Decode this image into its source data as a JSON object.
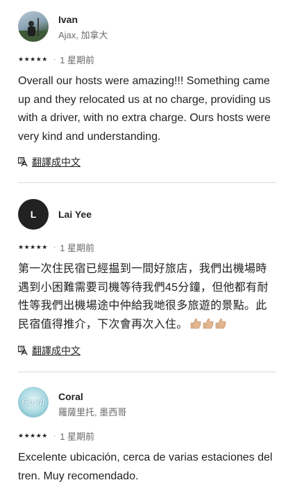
{
  "reviews": [
    {
      "name": "Ivan",
      "location": "Ajax, 加拿大",
      "stars": "★★★★★",
      "time": "1 星期前",
      "text": "Overall our hosts were amazing!!! Something came up and they relocated us at no charge, providing us with a driver, with no extra charge. Ours hosts were very kind and understanding.",
      "translate": "翻譯成中文",
      "avatar_icon": "user-photo-avatar"
    },
    {
      "name": "Lai Yee",
      "avatar_letter": "L",
      "stars": "★★★★★",
      "time": "1 星期前",
      "text": "第一次住民宿已經揾到一間好旅店，我們出機場時遇到小困難需要司機等待我們45分鐘，但他都有耐性等我們出機場途中仲給我哋很多旅遊的景點。此民宿值得推介，下次會再次入住。",
      "emoji": "👍🏼👍🏼👍🏼",
      "translate": "翻譯成中文"
    },
    {
      "name": "Coral",
      "location": "羅薩里托, 墨西哥",
      "avatar_logo": "Coral",
      "stars": "★★★★★",
      "time": "1 星期前",
      "text": "Excelente ubicación, cerca de varias estaciones del tren. Muy recomendado."
    }
  ],
  "colors": {
    "text": "#222222",
    "secondary": "#6a6a6a",
    "divider": "#dddddd"
  },
  "icons": {
    "translate": "translate-icon",
    "thumbs_up": "thumbs-up-icon"
  }
}
